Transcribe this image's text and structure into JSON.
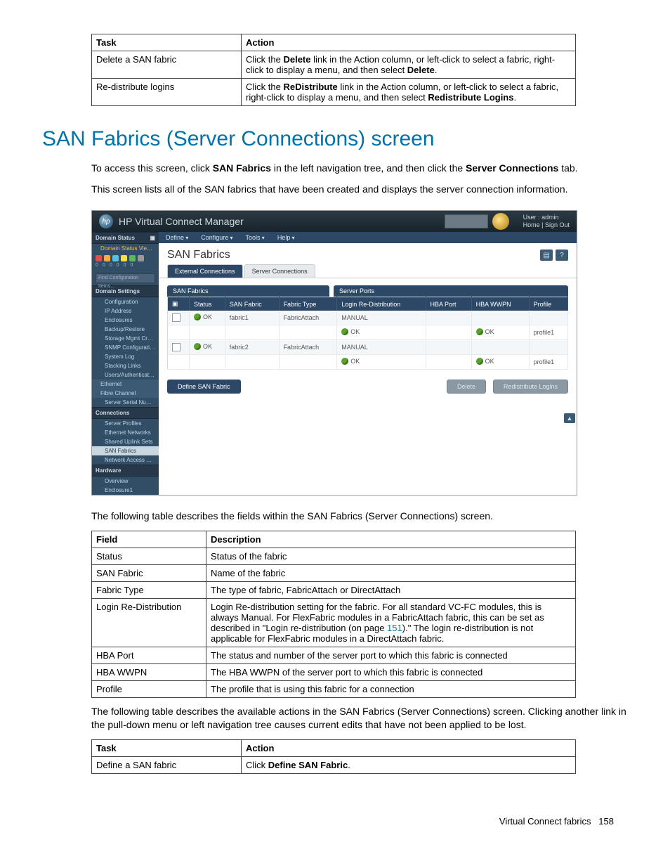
{
  "top_table": {
    "headers": [
      "Task",
      "Action"
    ],
    "rows": [
      {
        "task": "Delete a SAN fabric",
        "action_pre": "Click the ",
        "action_b1": "Delete",
        "action_mid": " link in the Action column, or left-click to select a fabric, right-click to display a menu, and then select ",
        "action_b2": "Delete",
        "action_post": "."
      },
      {
        "task": "Re-distribute logins",
        "action_pre": "Click the ",
        "action_b1": "ReDistribute",
        "action_mid": " link in the Action column, or left-click to select a fabric, right-click to display a menu, and then select ",
        "action_b2": "Redistribute Logins",
        "action_post": "."
      }
    ]
  },
  "section_heading": "SAN Fabrics (Server Connections) screen",
  "intro": {
    "p1_pre": "To access this screen, click ",
    "p1_b1": "SAN Fabrics",
    "p1_mid": " in the left navigation tree, and then click the ",
    "p1_b2": "Server Connections",
    "p1_post": " tab.",
    "p2": "This screen lists all of the SAN fabrics that have been created and displays the server connection information."
  },
  "vcm": {
    "app_title": "HP Virtual Connect Manager",
    "logo_text": "hp",
    "user_line1": "User : admin",
    "user_link_home": "Home",
    "user_link_signout": "Sign Out",
    "menu": {
      "define": "Define",
      "configure": "Configure",
      "tools": "Tools",
      "help": "Help"
    },
    "sidebar": {
      "domain_status": "Domain Status",
      "status_row": "Domain Status    View Legend…",
      "filter_placeholder": "Find Configuration Items…",
      "domain_settings": "Domain Settings",
      "items_ds": [
        "Configuration",
        "IP Address",
        "Enclosures",
        "Backup/Restore",
        "Storage Mgmt Credentials",
        "SNMP Configuration",
        "System Log",
        "Stacking Links",
        "Users/Authentication"
      ],
      "ethernet": "Ethernet",
      "fibre": "Fibre Channel",
      "items_fc": [
        "Server Serial Numbers"
      ],
      "connections": "Connections",
      "items_conn": [
        "Server Profiles",
        "Ethernet Networks",
        "Shared Uplink Sets",
        "SAN Fabrics",
        "Network Access Groups"
      ],
      "hardware": "Hardware",
      "items_hw": [
        "Overview",
        "Enclosure1"
      ]
    },
    "page_title": "SAN Fabrics",
    "tab_external": "External Connections",
    "tab_server": "Server Connections",
    "group_a": "SAN Fabrics",
    "group_b": "Server Ports",
    "columns": {
      "chk": "",
      "status": "Status",
      "san_fabric": "SAN Fabric",
      "fabric_type": "Fabric Type",
      "login": "Login Re-Distribution",
      "hba_port": "HBA Port",
      "hba_wwpn": "HBA WWPN",
      "profile": "Profile"
    },
    "rows": [
      {
        "status": "OK",
        "fabric": "fabric1",
        "type": "FabricAttach",
        "login": "MANUAL",
        "hba_port": "",
        "hba_wwpn": "",
        "profile": ""
      },
      {
        "status": "",
        "fabric": "",
        "type": "",
        "login": "OK",
        "hba_port": "",
        "hba_wwpn": "OK",
        "profile": "profile1"
      },
      {
        "status": "OK",
        "fabric": "fabric2",
        "type": "FabricAttach",
        "login": "MANUAL",
        "hba_port": "",
        "hba_wwpn": "",
        "profile": ""
      },
      {
        "status": "",
        "fabric": "",
        "type": "",
        "login": "OK",
        "hba_port": "",
        "hba_wwpn": "OK",
        "profile": "profile1"
      }
    ],
    "btn_define": "Define SAN Fabric",
    "btn_delete": "Delete",
    "btn_redist": "Redistribute Logins"
  },
  "fields_intro": "The following table describes the fields within the SAN Fabrics (Server Connections) screen.",
  "fields_table": {
    "headers": [
      "Field",
      "Description"
    ],
    "rows": [
      {
        "f": "Status",
        "d": "Status of the fabric"
      },
      {
        "f": "SAN Fabric",
        "d": "Name of the fabric"
      },
      {
        "f": "Fabric Type",
        "d": "The type of fabric, FabricAttach or DirectAttach"
      },
      {
        "f": "Login Re-Distribution",
        "d_pre": "Login Re-distribution setting for the fabric. For all standard VC-FC modules, this is always Manual. For FlexFabric modules in a FabricAttach fabric, this can be set as described in \"Login re-distribution (on page ",
        "d_link": "151",
        "d_post": ").\" The login re-distribution is not applicable for FlexFabric modules in a DirectAttach fabric."
      },
      {
        "f": "HBA Port",
        "d": "The status and number of the server port to which this fabric is connected"
      },
      {
        "f": "HBA WWPN",
        "d": "The HBA WWPN of the server port to which this fabric is connected"
      },
      {
        "f": "Profile",
        "d": "The profile that is using this fabric for a connection"
      }
    ]
  },
  "actions_intro": "The following table describes the available actions in the SAN Fabrics (Server Connections) screen. Clicking another link in the pull-down menu or left navigation tree causes current edits that have not been applied to be lost.",
  "actions_table": {
    "headers": [
      "Task",
      "Action"
    ],
    "rows": [
      {
        "task": "Define a SAN fabric",
        "action_pre": "Click ",
        "action_b1": "Define SAN Fabric",
        "action_post": "."
      }
    ]
  },
  "footer": {
    "label": "Virtual Connect fabrics",
    "page": "158"
  }
}
